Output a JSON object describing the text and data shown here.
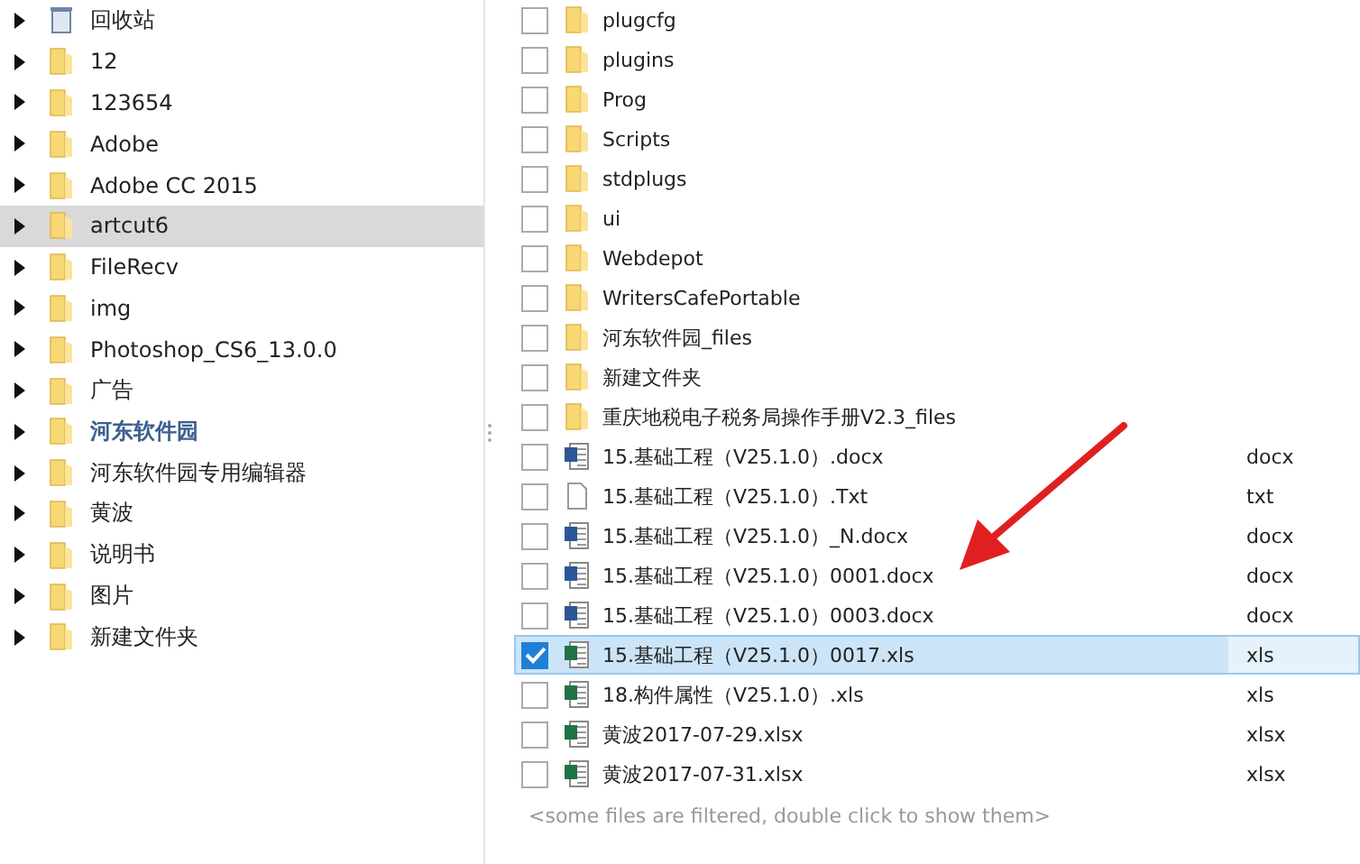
{
  "tree": {
    "items": [
      {
        "label": "回收站",
        "kind": "recycle",
        "selected": false,
        "highlighted": false
      },
      {
        "label": "12",
        "kind": "folder",
        "selected": false,
        "highlighted": false
      },
      {
        "label": "123654",
        "kind": "folder",
        "selected": false,
        "highlighted": false
      },
      {
        "label": "Adobe",
        "kind": "folder",
        "selected": false,
        "highlighted": false
      },
      {
        "label": "Adobe CC 2015",
        "kind": "folder",
        "selected": false,
        "highlighted": false
      },
      {
        "label": "artcut6",
        "kind": "folder",
        "selected": true,
        "highlighted": false
      },
      {
        "label": "FileRecv",
        "kind": "folder",
        "selected": false,
        "highlighted": false
      },
      {
        "label": "img",
        "kind": "folder",
        "selected": false,
        "highlighted": false
      },
      {
        "label": "Photoshop_CS6_13.0.0",
        "kind": "folder",
        "selected": false,
        "highlighted": false
      },
      {
        "label": "广告",
        "kind": "folder",
        "selected": false,
        "highlighted": false
      },
      {
        "label": "河东软件园",
        "kind": "folder",
        "selected": false,
        "highlighted": true
      },
      {
        "label": "河东软件园专用编辑器",
        "kind": "folder",
        "selected": false,
        "highlighted": false
      },
      {
        "label": "黄波",
        "kind": "folder",
        "selected": false,
        "highlighted": false
      },
      {
        "label": "说明书",
        "kind": "folder",
        "selected": false,
        "highlighted": false
      },
      {
        "label": "图片",
        "kind": "folder",
        "selected": false,
        "highlighted": false
      },
      {
        "label": "新建文件夹",
        "kind": "folder",
        "selected": false,
        "highlighted": false
      }
    ]
  },
  "files": {
    "rows": [
      {
        "name": "plugcfg",
        "kind": "folder",
        "checked": false,
        "selected": false
      },
      {
        "name": "plugins",
        "kind": "folder",
        "checked": false,
        "selected": false
      },
      {
        "name": "Prog",
        "kind": "folder",
        "checked": false,
        "selected": false
      },
      {
        "name": "Scripts",
        "kind": "folder",
        "checked": false,
        "selected": false
      },
      {
        "name": "stdplugs",
        "kind": "folder",
        "checked": false,
        "selected": false
      },
      {
        "name": "ui",
        "kind": "folder",
        "checked": false,
        "selected": false
      },
      {
        "name": "Webdepot",
        "kind": "folder",
        "checked": false,
        "selected": false
      },
      {
        "name": "WritersCafePortable",
        "kind": "folder",
        "checked": false,
        "selected": false
      },
      {
        "name": "河东软件园_files",
        "kind": "folder",
        "checked": false,
        "selected": false
      },
      {
        "name": "新建文件夹",
        "kind": "folder",
        "checked": false,
        "selected": false
      },
      {
        "name": "重庆地税电子税务局操作手册V2.3_files",
        "kind": "folder",
        "checked": false,
        "selected": false
      },
      {
        "name": "15.基础工程（V25.1.0）.docx",
        "type": "docx",
        "kind": "word",
        "checked": false,
        "selected": false
      },
      {
        "name": "15.基础工程（V25.1.0）.Txt",
        "type": "txt",
        "kind": "text",
        "checked": false,
        "selected": false
      },
      {
        "name": "15.基础工程（V25.1.0）_N.docx",
        "type": "docx",
        "kind": "word",
        "checked": false,
        "selected": false
      },
      {
        "name": "15.基础工程（V25.1.0）0001.docx",
        "type": "docx",
        "kind": "word",
        "checked": false,
        "selected": false
      },
      {
        "name": "15.基础工程（V25.1.0）0003.docx",
        "type": "docx",
        "kind": "word",
        "checked": false,
        "selected": false
      },
      {
        "name": "15.基础工程（V25.1.0）0017.xls",
        "type": "xls",
        "kind": "excel",
        "checked": true,
        "selected": true
      },
      {
        "name": "18.构件属性（V25.1.0）.xls",
        "type": "xls",
        "kind": "excel",
        "checked": false,
        "selected": false
      },
      {
        "name": "黄波2017-07-29.xlsx",
        "type": "xlsx",
        "kind": "excel",
        "checked": false,
        "selected": false
      },
      {
        "name": "黄波2017-07-31.xlsx",
        "type": "xlsx",
        "kind": "excel",
        "checked": false,
        "selected": false
      }
    ],
    "footer": "<some files are filtered, double click to show them>"
  }
}
